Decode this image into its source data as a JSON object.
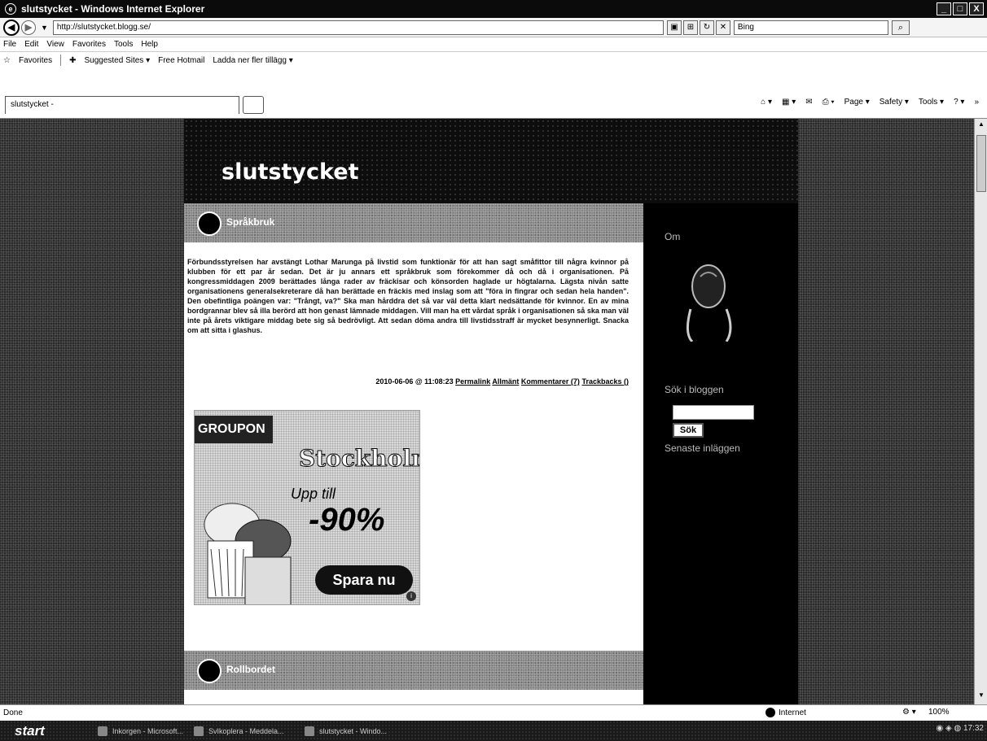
{
  "window": {
    "title": "slutstycket - Windows Internet Explorer",
    "controls": [
      "_",
      "□",
      "X"
    ]
  },
  "address": {
    "url": "http://slutstycket.blogg.se/",
    "search_placeholder": "Bing"
  },
  "menu": [
    "File",
    "Edit",
    "View",
    "Favorites",
    "Tools",
    "Help"
  ],
  "favorites_bar": {
    "favorites_label": "Favorites",
    "items": [
      "Suggested Sites ▾",
      "Free Hotmail",
      "Ladda ner fler tillägg ▾"
    ]
  },
  "tab": {
    "label": "slutstycket -"
  },
  "command_bar": [
    "Page ▾",
    "Safety ▾",
    "Tools ▾"
  ],
  "blog": {
    "title": "slutstycket",
    "posts": [
      {
        "heading": "Språkbruk",
        "body": "Förbundsstyrelsen har avstängt Lothar Marunga på livstid som funktionär för att han sagt småfittor till några kvinnor på klubben för ett par år sedan. Det är ju annars ett språkbruk som förekommer då och då i organisationen. På kongressmiddagen 2009 berättades långa rader av fräckisar och könsorden haglade ur högtalarna. Lägsta nivån satte organisationens generalsekreterare då han berättade en fräckis med inslag som att \"föra in fingrar och sedan hela handen\". Den obefintliga poängen var: \"Trångt, va?\" Ska man hårddra det så var väl detta klart nedsättande för kvinnor. En av mina bordgrannar blev så illa berörd att hon genast lämnade middagen. Vill man ha ett vårdat språk i organisationen så ska man väl inte på årets viktigare middag bete sig så bedrövligt. Att sedan döma andra till livstidsstraff är mycket besynnerligt. Snacka om att sitta i glashus.",
        "timestamp": "2010-06-06 @ 11:08:23",
        "links": [
          "Permalink",
          "Allmänt",
          "Kommentarer (7)",
          "Trackbacks ()"
        ]
      },
      {
        "heading": "Rollbordet"
      }
    ],
    "ad": {
      "brand": "GROUPON",
      "city": "Stockholm",
      "line": "Upp till",
      "discount": "-90%",
      "cta": "Spara nu"
    },
    "sidebar": {
      "about_label": "Om",
      "search_label": "Sök i bloggen",
      "search_button": "Sök",
      "latest_label": "Senaste inläggen"
    }
  },
  "status": {
    "left": "Done",
    "zone": "Internet",
    "zoom": "100%"
  },
  "taskbar": {
    "start": "start",
    "items": [
      "Inkorgen - Microsoft...",
      "SvIkoplera - Meddela...",
      "slutstycket - Windo..."
    ],
    "clock": "17:32"
  }
}
